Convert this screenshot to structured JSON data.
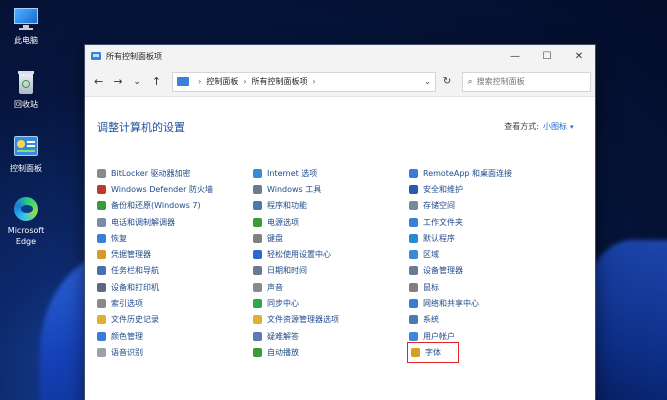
{
  "desktop": {
    "icons": [
      {
        "label": "此电脑",
        "icon": "monitor-icon"
      },
      {
        "label": "回收站",
        "icon": "recycle-bin-icon"
      },
      {
        "label": "控制面板",
        "icon": "control-panel-icon"
      },
      {
        "label": "Microsoft Edge",
        "icon": "edge-icon"
      }
    ]
  },
  "window": {
    "title": "所有控制面板项",
    "controls": {
      "minimize": "—",
      "maximize": "☐",
      "close": "✕"
    }
  },
  "nav": {
    "back": "←",
    "forward": "→",
    "dropdown": "⌄",
    "up": "↑",
    "breadcrumb": [
      "控制面板",
      "所有控制面板项"
    ],
    "refresh": "↻",
    "search_placeholder": "搜索控制面板"
  },
  "content": {
    "heading": "调整计算机的设置",
    "view_by_label": "查看方式:",
    "view_by_value": "小图标",
    "columns": [
      [
        {
          "label": "BitLocker 驱动器加密",
          "color": "#8a8a8a"
        },
        {
          "label": "Windows Defender 防火墙",
          "color": "#c0392b"
        },
        {
          "label": "备份和还原(Windows 7)",
          "color": "#3a9b3a"
        },
        {
          "label": "电话和调制解调器",
          "color": "#7a8da8"
        },
        {
          "label": "恢复",
          "color": "#3b7fd9"
        },
        {
          "label": "凭据管理器",
          "color": "#d49a2a"
        },
        {
          "label": "任务栏和导航",
          "color": "#4a6fb0"
        },
        {
          "label": "设备和打印机",
          "color": "#5a6a80"
        },
        {
          "label": "索引选项",
          "color": "#8a8a8a"
        },
        {
          "label": "文件历史记录",
          "color": "#e0b030"
        },
        {
          "label": "颜色管理",
          "color": "#3a7bd5"
        },
        {
          "label": "语音识别",
          "color": "#9aa0a8"
        }
      ],
      [
        {
          "label": "Internet 选项",
          "color": "#3b8ad9"
        },
        {
          "label": "Windows 工具",
          "color": "#6a7a90"
        },
        {
          "label": "程序和功能",
          "color": "#4a7ab0"
        },
        {
          "label": "电源选项",
          "color": "#3a9b3a"
        },
        {
          "label": "键盘",
          "color": "#808080"
        },
        {
          "label": "轻松使用设置中心",
          "color": "#2a6ad0"
        },
        {
          "label": "日期和时间",
          "color": "#6a7a90"
        },
        {
          "label": "声音",
          "color": "#8a8a8a"
        },
        {
          "label": "同步中心",
          "color": "#2aa84a"
        },
        {
          "label": "文件资源管理器选项",
          "color": "#e0b030"
        },
        {
          "label": "疑难解答",
          "color": "#5a7ab0"
        },
        {
          "label": "自动播放",
          "color": "#3a9b3a"
        }
      ],
      [
        {
          "label": "RemoteApp 和桌面连接",
          "color": "#3a7bd5"
        },
        {
          "label": "安全和维护",
          "color": "#2a5ab0"
        },
        {
          "label": "存储空间",
          "color": "#7a8a9a"
        },
        {
          "label": "工作文件夹",
          "color": "#3b7fd9"
        },
        {
          "label": "默认程序",
          "color": "#2a8ad0"
        },
        {
          "label": "区域",
          "color": "#3a8ad9"
        },
        {
          "label": "设备管理器",
          "color": "#6a7a90"
        },
        {
          "label": "鼠标",
          "color": "#808080"
        },
        {
          "label": "网络和共享中心",
          "color": "#3a7bd5"
        },
        {
          "label": "系统",
          "color": "#4a7ab0"
        },
        {
          "label": "用户帐户",
          "color": "#3a8ad9"
        },
        {
          "label": "字体",
          "color": "#d4a020"
        }
      ]
    ]
  }
}
